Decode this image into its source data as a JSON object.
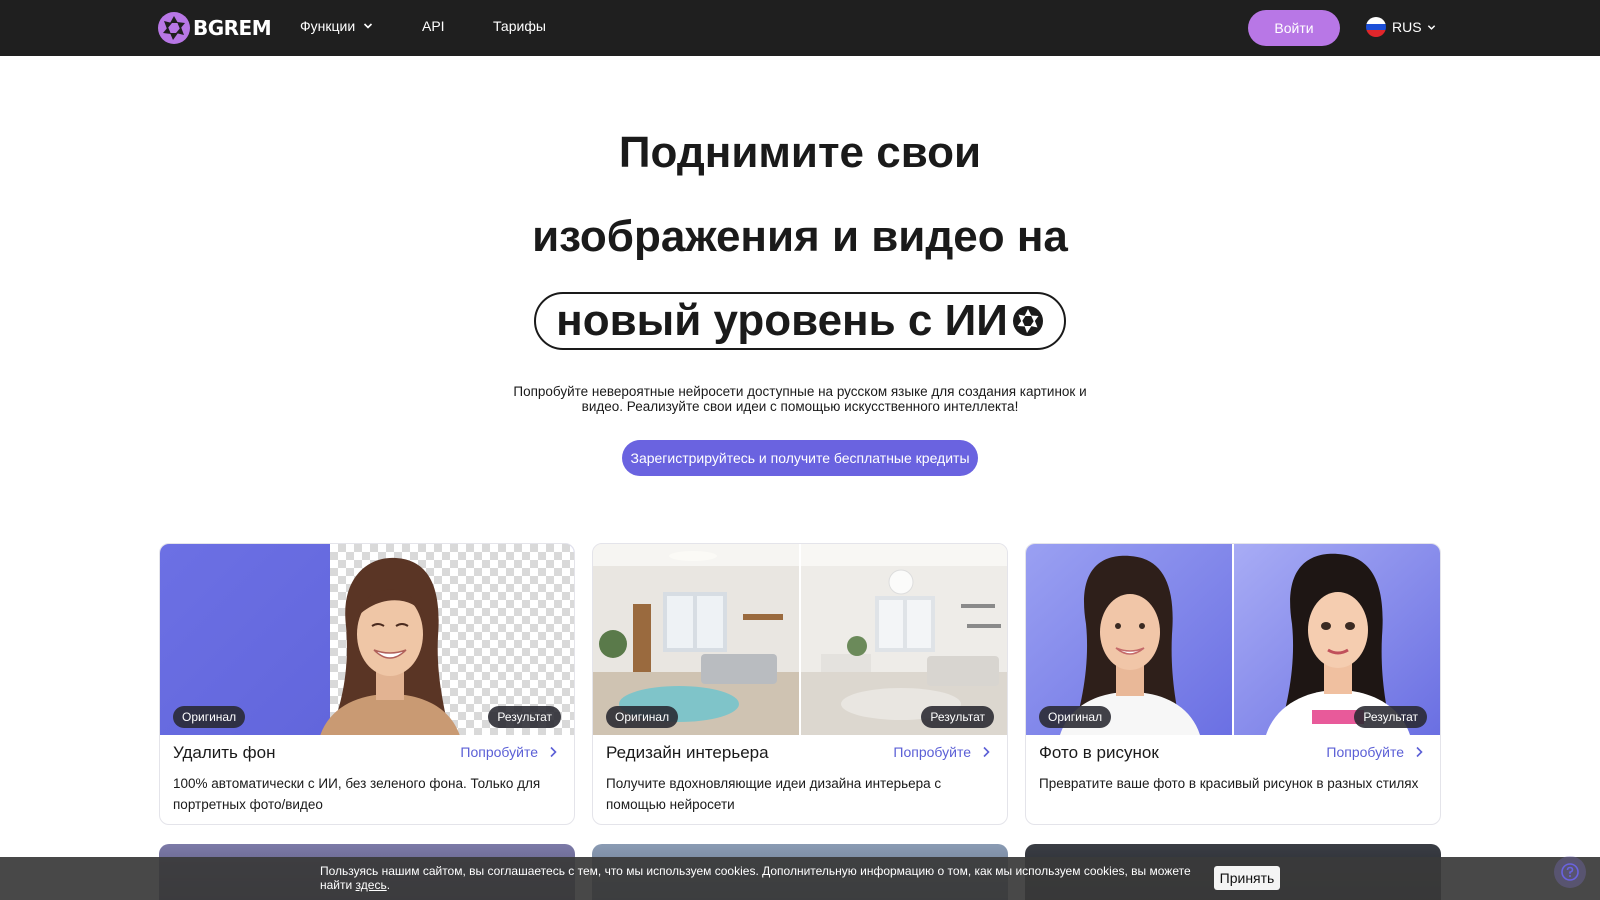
{
  "header": {
    "logo_text": "BGREM",
    "nav": [
      {
        "label": "Функции",
        "has_dropdown": true
      },
      {
        "label": "API"
      },
      {
        "label": "Тарифы"
      }
    ],
    "login_label": "Войти",
    "language": "RUS"
  },
  "hero": {
    "line1": "Поднимите свои",
    "line2": "изображения и видео на",
    "line3": "новый уровень с ИИ",
    "subtitle": "Попробуйте невероятные нейросети доступные на русском языке для создания картинок и видео. Реализуйте свои идеи с помощью искусственного интеллекта!",
    "cta_label": "Зарегистрируйтесь и получите бесплатные кредиты"
  },
  "cards": [
    {
      "badge_original": "Оригинал",
      "badge_result": "Результат",
      "title": "Удалить фон",
      "try_label": "Попробуйте",
      "description": "100% автоматически с ИИ, без зеленого фона. Только для портретных фото/видео"
    },
    {
      "badge_original": "Оригинал",
      "badge_result": "Результат",
      "title": "Редизайн интерьера",
      "try_label": "Попробуйте",
      "description": "Получите вдохновляющие идеи дизайна интерьера с помощью нейросети"
    },
    {
      "badge_original": "Оригинал",
      "badge_result": "Результат",
      "title": "Фото в рисунок",
      "try_label": "Попробуйте",
      "description": "Превратите ваше фото в красивый рисунок в разных стилях"
    }
  ],
  "cookie": {
    "text": "Пользуясь нашим сайтом, вы соглашаетесь с тем, что мы используем cookies. Дополнительную информацию о том, как мы используем cookies, вы можете найти ",
    "link_label": "здесь",
    "tail": ".",
    "accept_label": "Принять"
  },
  "colors": {
    "header_bg": "#1f1f1f",
    "login_bg": "#b877e6",
    "cta_bg": "#6a63e0",
    "link": "#5b5fd6"
  },
  "icons": [
    "logo-aperture-icon",
    "chevron-down-icon",
    "russia-flag-icon",
    "ai-aperture-icon",
    "chevron-right-icon",
    "chat-help-icon"
  ]
}
